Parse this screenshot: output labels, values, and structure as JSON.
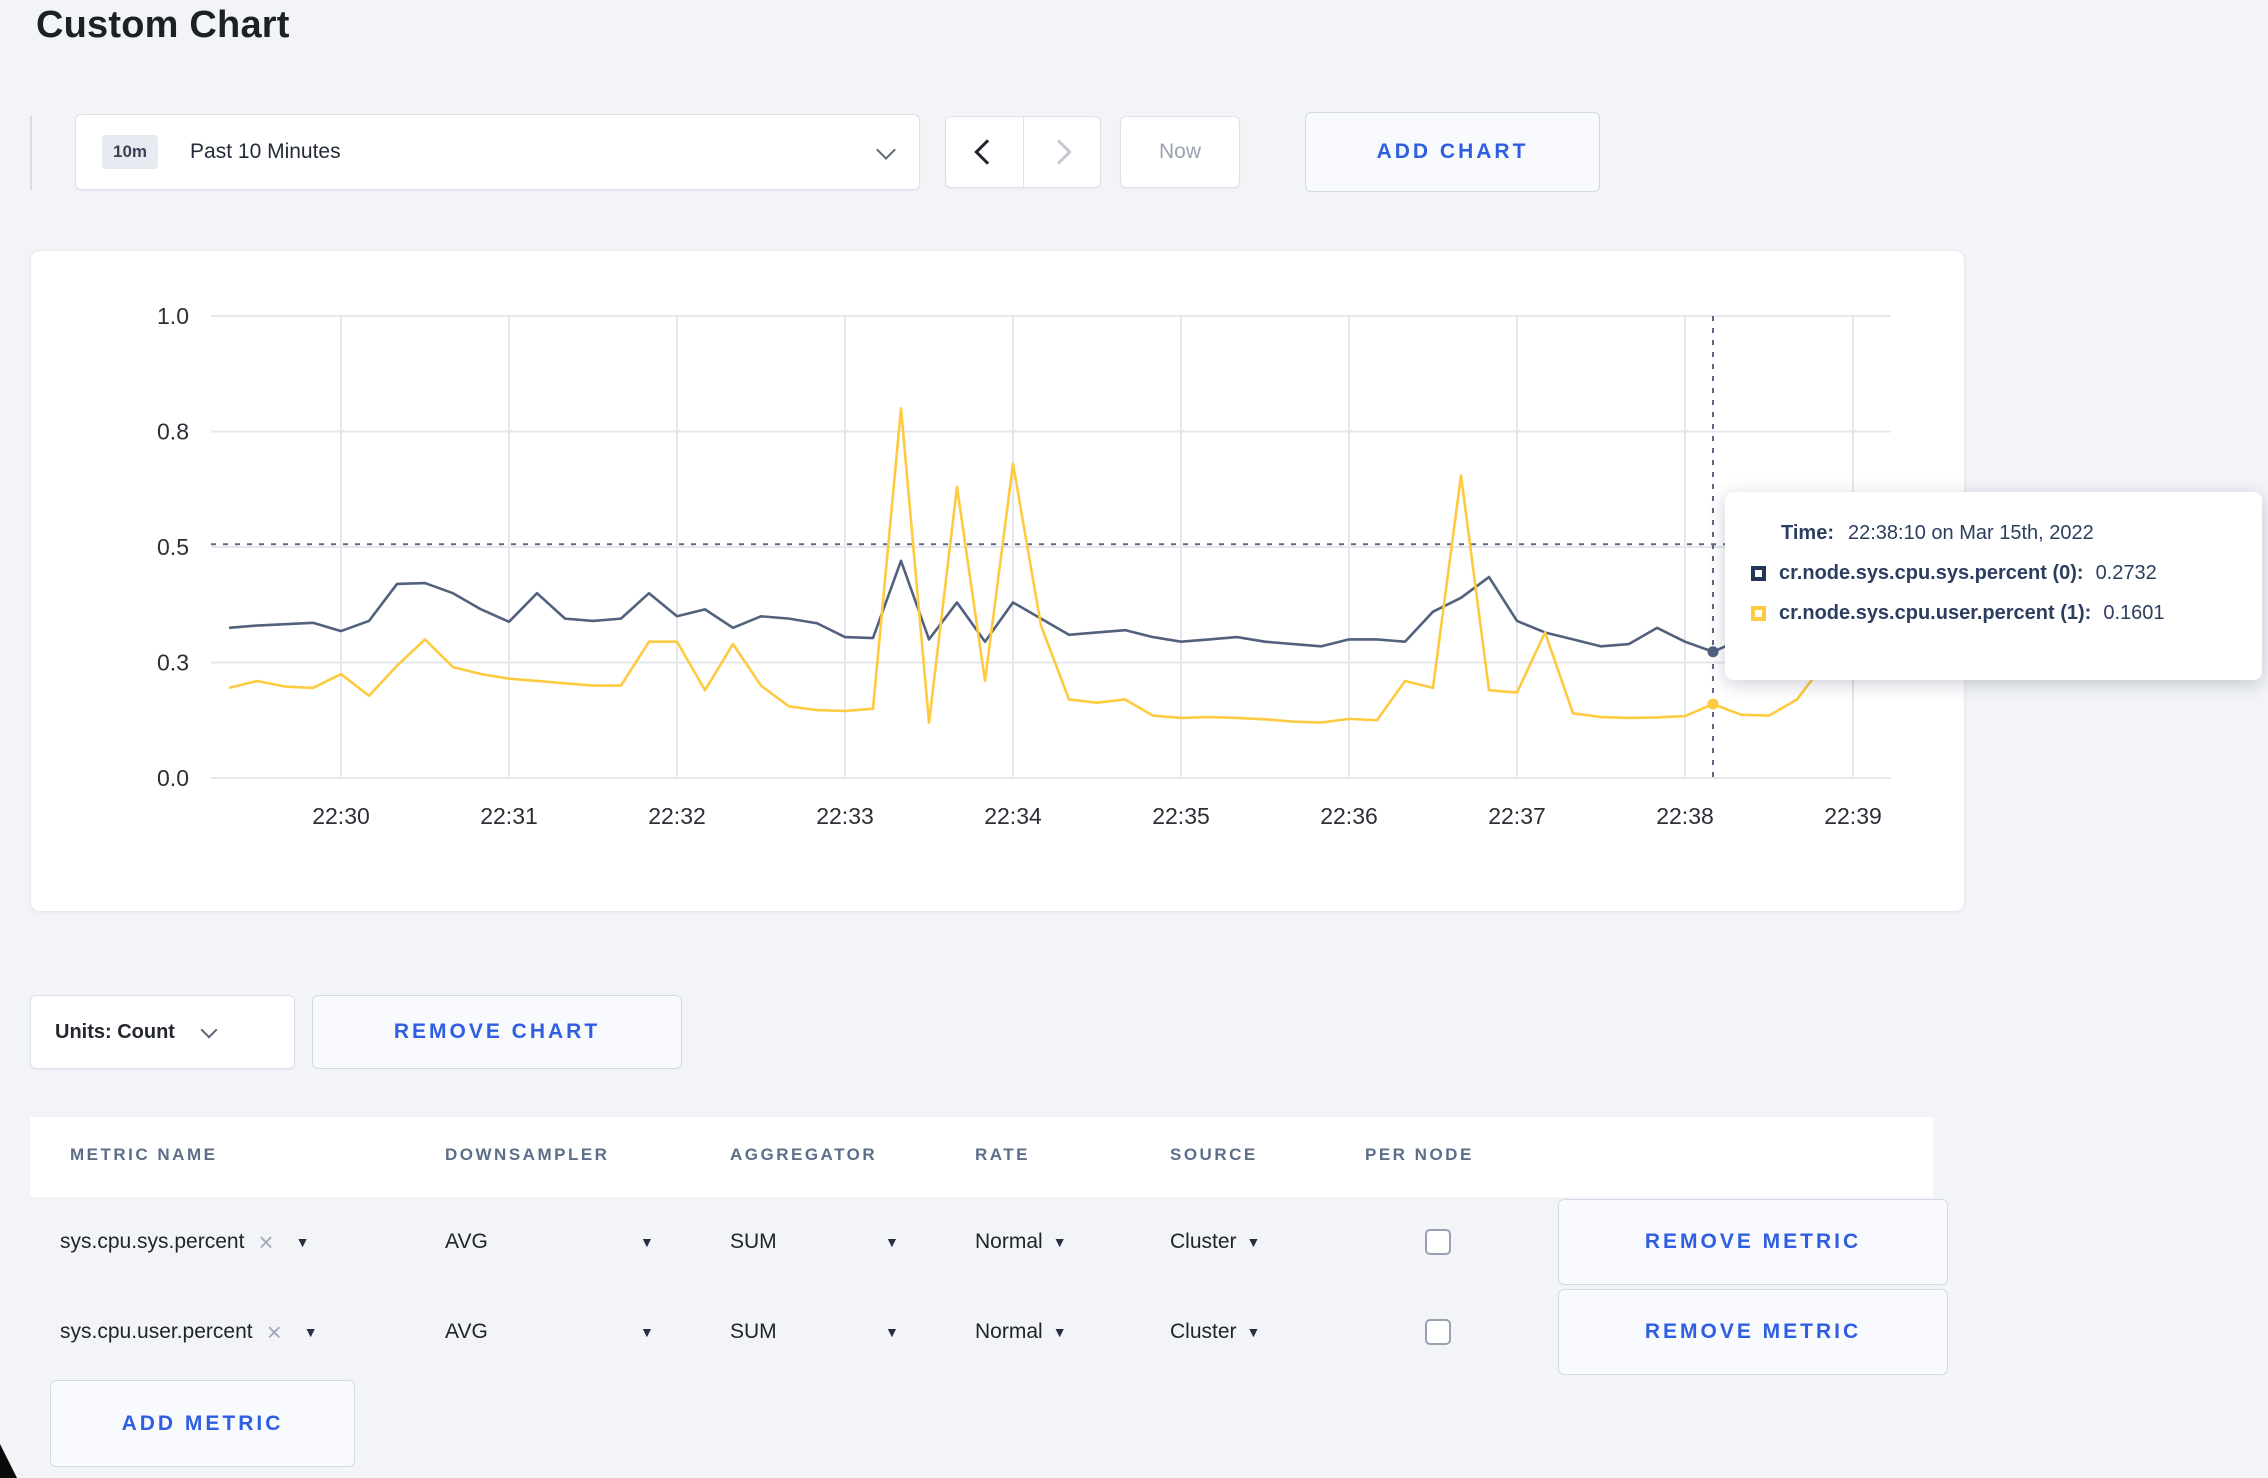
{
  "header": {
    "title": "Custom Chart"
  },
  "toolbar": {
    "time_window_badge": "10m",
    "time_window_label": "Past 10 Minutes",
    "now_label": "Now",
    "add_chart_label": "ADD CHART"
  },
  "chart_actions": {
    "units_label": "Units: Count",
    "remove_chart_label": "REMOVE CHART"
  },
  "tooltip": {
    "time_label": "Time:",
    "time_value": "22:38:10 on Mar 15th, 2022",
    "series": [
      {
        "name": "cr.node.sys.cpu.sys.percent (0):",
        "value": "0.2732",
        "color": "#233659"
      },
      {
        "name": "cr.node.sys.cpu.user.percent (1):",
        "value": "0.1601",
        "color": "#fdca40"
      }
    ]
  },
  "chart_data": {
    "type": "line",
    "title": "",
    "xlabel": "",
    "ylabel": "",
    "ylim": [
      0,
      1
    ],
    "grid": true,
    "legend_position": "tooltip",
    "x_start": "22:29:20",
    "x_step_seconds": 10,
    "x_ticks": [
      "22:30",
      "22:31",
      "22:32",
      "22:33",
      "22:34",
      "22:35",
      "22:36",
      "22:37",
      "22:38",
      "22:39"
    ],
    "y_ticks": [
      {
        "label": "0.0",
        "value": 0
      },
      {
        "label": "0.3",
        "value": 0.25
      },
      {
        "label": "0.5",
        "value": 0.5
      },
      {
        "label": "0.8",
        "value": 0.75
      },
      {
        "label": "1.0",
        "value": 1.0
      }
    ],
    "crosshair": {
      "time": "22:38:10",
      "point_index": 53,
      "y_value": 0.506
    },
    "series": [
      {
        "name": "cr.node.sys.cpu.sys.percent (0)",
        "color": "#52617e",
        "hover_value": 0.2732,
        "values": [
          0.325,
          0.33,
          0.333,
          0.336,
          0.318,
          0.34,
          0.42,
          0.422,
          0.4,
          0.365,
          0.338,
          0.4,
          0.345,
          0.34,
          0.345,
          0.4,
          0.35,
          0.365,
          0.325,
          0.35,
          0.345,
          0.335,
          0.305,
          0.303,
          0.47,
          0.3,
          0.38,
          0.295,
          0.38,
          0.345,
          0.31,
          0.315,
          0.32,
          0.305,
          0.295,
          0.3,
          0.305,
          0.295,
          0.29,
          0.285,
          0.3,
          0.3,
          0.295,
          0.36,
          0.39,
          0.435,
          0.34,
          0.315,
          0.3,
          0.285,
          0.29,
          0.325,
          0.295,
          0.2732,
          0.3,
          0.315,
          0.3,
          0.305,
          0.31,
          0.3
        ]
      },
      {
        "name": "cr.node.sys.cpu.user.percent (1)",
        "color": "#fdca40",
        "hover_value": 0.1601,
        "values": [
          0.195,
          0.21,
          0.198,
          0.195,
          0.225,
          0.178,
          0.243,
          0.3,
          0.24,
          0.225,
          0.215,
          0.21,
          0.205,
          0.2,
          0.2,
          0.295,
          0.295,
          0.19,
          0.29,
          0.2,
          0.155,
          0.147,
          0.145,
          0.15,
          0.8,
          0.12,
          0.63,
          0.21,
          0.68,
          0.33,
          0.17,
          0.163,
          0.17,
          0.135,
          0.13,
          0.132,
          0.13,
          0.127,
          0.122,
          0.12,
          0.128,
          0.125,
          0.21,
          0.195,
          0.655,
          0.19,
          0.185,
          0.315,
          0.14,
          0.132,
          0.13,
          0.131,
          0.134,
          0.1601,
          0.137,
          0.135,
          0.17,
          0.25,
          0.24,
          0.27
        ]
      }
    ]
  },
  "metrics": {
    "headers": [
      "METRIC NAME",
      "DOWNSAMPLER",
      "AGGREGATOR",
      "RATE",
      "SOURCE",
      "PER NODE"
    ],
    "remove_metric_label": "REMOVE METRIC",
    "add_metric_label": "ADD METRIC",
    "clear_icon": "×",
    "dropdown_arrow": "▼",
    "rows": [
      {
        "name": "sys.cpu.sys.percent",
        "downsampler": "AVG",
        "aggregator": "SUM",
        "rate": "Normal",
        "source": "Cluster",
        "per_node_checked": false
      },
      {
        "name": "sys.cpu.user.percent",
        "downsampler": "AVG",
        "aggregator": "SUM",
        "rate": "Normal",
        "source": "Cluster",
        "per_node_checked": false
      }
    ]
  }
}
